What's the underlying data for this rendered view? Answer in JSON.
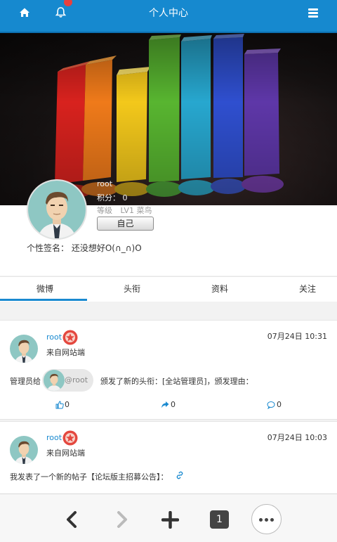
{
  "header": {
    "title": "个人中心"
  },
  "profile": {
    "username": "root",
    "points_label": "积分：",
    "points_value": "0",
    "level_label": "等级",
    "level_value": "LV1 菜鸟",
    "self_button": "自己",
    "signature_label": "个性签名：",
    "signature": "还没想好O(∩_∩)O"
  },
  "tabs": [
    "微博",
    "头衔",
    "资料",
    "关注"
  ],
  "posts": [
    {
      "name": "root",
      "from": "来自网站端",
      "time": "07月24日 10:31",
      "body_prefix": "管理员给",
      "mention": "@root",
      "body_suffix": "颁发了新的头衔：[全站管理员]，颁发理由：",
      "likes": "0",
      "shares": "0",
      "comments": "0"
    },
    {
      "name": "root",
      "from": "来自网站端",
      "time": "07月24日 10:03",
      "body": "我发表了一个新的帖子【论坛版主招募公告】："
    }
  ],
  "browser": {
    "tab_count": "1"
  },
  "colors": {
    "accent": "#1689cf",
    "notification": "#e8403e"
  }
}
